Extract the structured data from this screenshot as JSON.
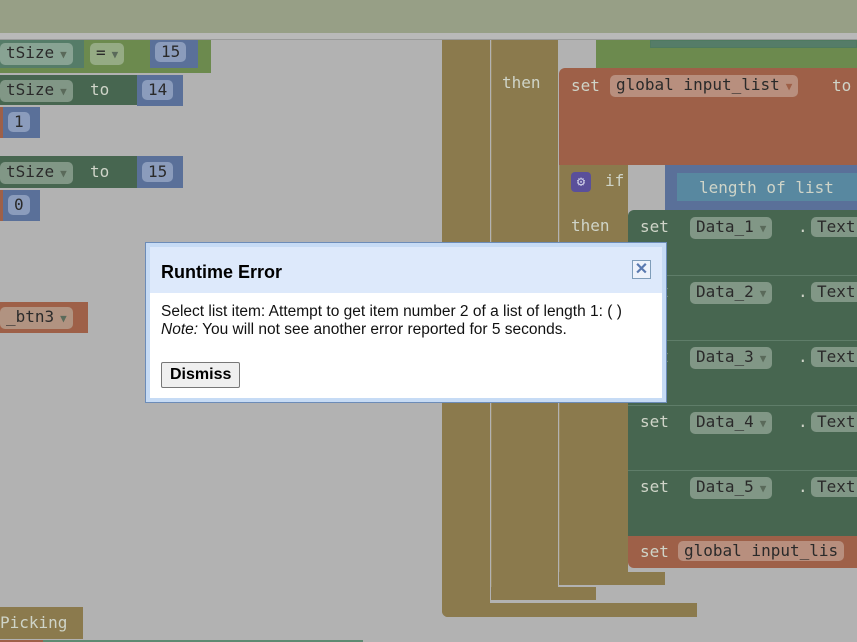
{
  "left_blocks": {
    "row1": {
      "var": "tSize",
      "op": "=",
      "value": "15"
    },
    "row2": {
      "var": "tSize",
      "to": "to",
      "value": "14"
    },
    "row3": {
      "value": "1"
    },
    "row4": {
      "var": "tSize",
      "to": "to",
      "value": "15"
    },
    "row5": {
      "value": "0"
    },
    "row6": {
      "var": "_btn3"
    },
    "row7": {
      "label": "Picking"
    }
  },
  "right_blocks": {
    "then1": "then",
    "set_global": {
      "set": "set",
      "var": "global input_list",
      "to": "to"
    },
    "if": "if",
    "length_of_list": "length of list",
    "then2": "then",
    "data_rows": [
      {
        "set": "set",
        "component": "Data_1",
        "dot": ".",
        "prop": "Text"
      },
      {
        "set": "set",
        "component": "Data_2",
        "dot": ".",
        "prop": "Text"
      },
      {
        "set": "set",
        "component": "Data_3",
        "dot": ".",
        "prop": "Text"
      },
      {
        "set": "set",
        "component": "Data_4",
        "dot": ".",
        "prop": "Text"
      },
      {
        "set": "set",
        "component": "Data_5",
        "dot": ".",
        "prop": "Text"
      }
    ],
    "set_global_bottom": {
      "set": "set",
      "var": "global input_lis"
    }
  },
  "dialog": {
    "title": "Runtime Error",
    "message": "Select list item: Attempt to get item number 2 of a list of length 1: ( )",
    "note_label": "Note:",
    "note": " You will not see another error reported for 5 seconds.",
    "dismiss": "Dismiss",
    "close": "✕"
  }
}
